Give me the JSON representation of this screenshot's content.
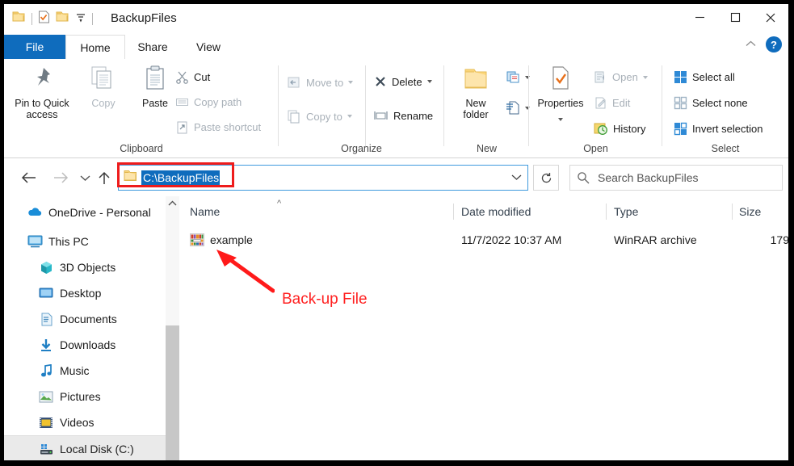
{
  "window": {
    "title": "BackupFiles",
    "quick_access": [
      "folder-icon",
      "properties-check-icon",
      "new-folder-icon",
      "qat-dropdown-icon"
    ],
    "controls": {
      "minimize": "—",
      "maximize": "□",
      "close": "✕"
    },
    "ribbon_collapse": "^",
    "help": "?"
  },
  "tabs": [
    {
      "label": "File"
    },
    {
      "label": "Home"
    },
    {
      "label": "Share"
    },
    {
      "label": "View"
    }
  ],
  "ribbon": {
    "groups": [
      {
        "label": "Clipboard"
      },
      {
        "label": "Organize"
      },
      {
        "label": "New"
      },
      {
        "label": "Open"
      },
      {
        "label": "Select"
      }
    ],
    "clipboard": {
      "pin_label_1": "Pin to Quick",
      "pin_label_2": "access",
      "copy": "Copy",
      "paste": "Paste",
      "cut": "Cut",
      "copy_path": "Copy path",
      "paste_shortcut": "Paste shortcut"
    },
    "organize": {
      "move_to": "Move to",
      "copy_to": "Copy to",
      "delete": "Delete",
      "rename": "Rename"
    },
    "new": {
      "new_folder_1": "New",
      "new_folder_2": "folder"
    },
    "open": {
      "properties": "Properties",
      "open": "Open",
      "edit": "Edit",
      "history": "History"
    },
    "select": {
      "select_all": "Select all",
      "select_none": "Select none",
      "invert_selection": "Invert selection"
    }
  },
  "address": {
    "path_value": "C:\\BackupFiles",
    "search_placeholder": "Search BackupFiles",
    "highlight_color": "#ee1c1c"
  },
  "navigation": {
    "items": [
      {
        "label": "OneDrive - Personal",
        "icon": "onedrive-cloud-icon",
        "indent": 28,
        "selected": false
      },
      {
        "label": "This PC",
        "icon": "this-pc-icon",
        "indent": 28,
        "selected": false
      },
      {
        "label": "3D Objects",
        "icon": "3d-objects-icon",
        "indent": 42,
        "selected": false
      },
      {
        "label": "Desktop",
        "icon": "desktop-icon",
        "indent": 42,
        "selected": false
      },
      {
        "label": "Documents",
        "icon": "documents-icon",
        "indent": 42,
        "selected": false
      },
      {
        "label": "Downloads",
        "icon": "downloads-icon",
        "indent": 42,
        "selected": false
      },
      {
        "label": "Music",
        "icon": "music-icon",
        "indent": 42,
        "selected": false
      },
      {
        "label": "Pictures",
        "icon": "pictures-icon",
        "indent": 42,
        "selected": false
      },
      {
        "label": "Videos",
        "icon": "videos-icon",
        "indent": 42,
        "selected": false
      },
      {
        "label": "Local Disk (C:)",
        "icon": "local-disk-icon",
        "indent": 42,
        "selected": true
      }
    ]
  },
  "file_list": {
    "columns": [
      "Name",
      "Date modified",
      "Type",
      "Size"
    ],
    "sort_column": "Name",
    "rows": [
      {
        "name": "example",
        "icon": "winrar-archive-icon",
        "date_modified": "11/7/2022 10:37 AM",
        "type": "WinRAR archive",
        "size": "179"
      }
    ]
  },
  "annotation": {
    "label": "Back-up File",
    "color": "#ff2020"
  }
}
